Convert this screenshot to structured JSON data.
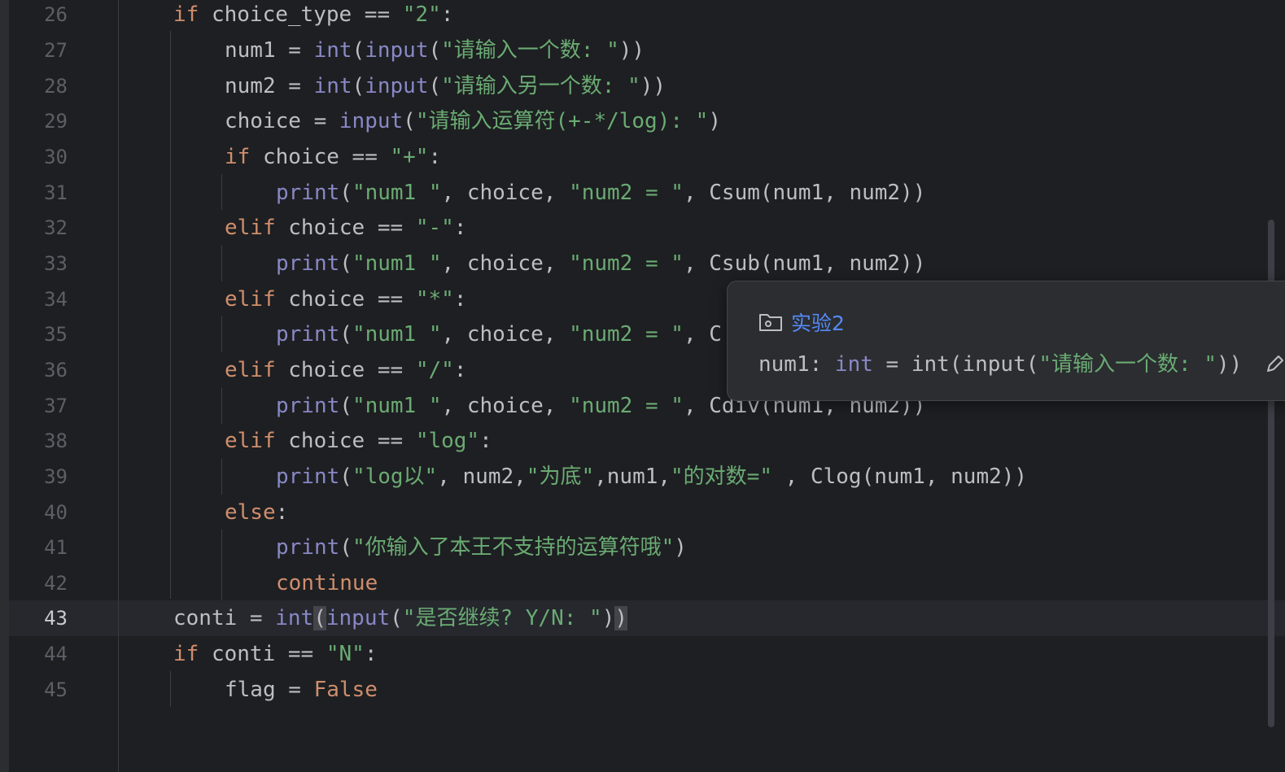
{
  "editor": {
    "line_numbers": [
      "26",
      "27",
      "28",
      "29",
      "30",
      "31",
      "32",
      "33",
      "34",
      "35",
      "36",
      "37",
      "38",
      "39",
      "40",
      "41",
      "42",
      "43",
      "44",
      "45"
    ],
    "current_line": "43",
    "lines": {
      "l26": {
        "kw": "if",
        "a": " choice_type == ",
        "s": "\"2\"",
        "b": ":"
      },
      "l27": {
        "a": "num1 = ",
        "f1": "int",
        "b": "(",
        "f2": "input",
        "c": "(",
        "s": "\"请输入一个数: \"",
        "d": "))"
      },
      "l28": {
        "a": "num2 = ",
        "f1": "int",
        "b": "(",
        "f2": "input",
        "c": "(",
        "s": "\"请输入另一个数: \"",
        "d": "))"
      },
      "l29": {
        "a": "choice = ",
        "f": "input",
        "b": "(",
        "s": "\"请输入运算符(+-*/log): \"",
        "c": ")"
      },
      "l30": {
        "kw": "if",
        "a": " choice == ",
        "s": "\"+\"",
        "b": ":"
      },
      "l31": {
        "f": "print",
        "a": "(",
        "s1": "\"num1 \"",
        "b": ", choice, ",
        "s2": "\"num2 = \"",
        "c": ", Csum(num1, num2))"
      },
      "l32": {
        "kw": "elif",
        "a": " choice == ",
        "s": "\"-\"",
        "b": ":"
      },
      "l33": {
        "f": "print",
        "a": "(",
        "s1": "\"num1 \"",
        "b": ", choice, ",
        "s2": "\"num2 = \"",
        "c": ", Csub(num1, num2))"
      },
      "l34": {
        "kw": "elif",
        "a": " choice == ",
        "s": "\"*\"",
        "b": ":"
      },
      "l35": {
        "f": "print",
        "a": "(",
        "s1": "\"num1 \"",
        "b": ", choice, ",
        "s2": "\"num2 = \"",
        "c": ", C"
      },
      "l36": {
        "kw": "elif",
        "a": " choice == ",
        "s": "\"/\"",
        "b": ":"
      },
      "l37": {
        "f": "print",
        "a": "(",
        "s1": "\"num1 \"",
        "b": ", choice, ",
        "s2": "\"num2 = \"",
        "c": ", Cdiv(num1, num2))"
      },
      "l38": {
        "kw": "elif",
        "a": " choice == ",
        "s": "\"log\"",
        "b": ":"
      },
      "l39": {
        "f": "print",
        "a": "(",
        "s1": "\"log以\"",
        "b": ", num2,",
        "s2": "\"为底\"",
        "c": ",num1,",
        "s3": "\"的对数=\"",
        "d": " , Clog(num1, num2))"
      },
      "l40": {
        "kw": "else",
        "a": ":"
      },
      "l41": {
        "f": "print",
        "a": "(",
        "s": "\"你输入了本王不支持的运算符哦\"",
        "b": ")"
      },
      "l42": {
        "kw": "continue"
      },
      "l43": {
        "a": "conti = ",
        "f1": "int",
        "b": "(",
        "f2": "input",
        "c": "(",
        "s": "\"是否继续? Y/N: \"",
        "d": ")",
        "e": ")"
      },
      "l44": {
        "kw": "if",
        "a": " conti == ",
        "s": "\"N\"",
        "b": ":"
      },
      "l45": {
        "a": "flag = ",
        "kw": "False"
      }
    }
  },
  "popup": {
    "folder_icon": "folder-icon",
    "title": "实验2",
    "sig_name": "num1: ",
    "sig_type": "int",
    "sig_eq": " = int(input(",
    "sig_str": "\"请输入一个数: \"",
    "sig_end": "))",
    "edit_icon": "pencil-icon"
  },
  "colors": {
    "background": "#1e1f22",
    "keyword": "#cf8e6d",
    "builtin": "#8888c6",
    "string": "#6aab73",
    "link": "#548af7"
  }
}
